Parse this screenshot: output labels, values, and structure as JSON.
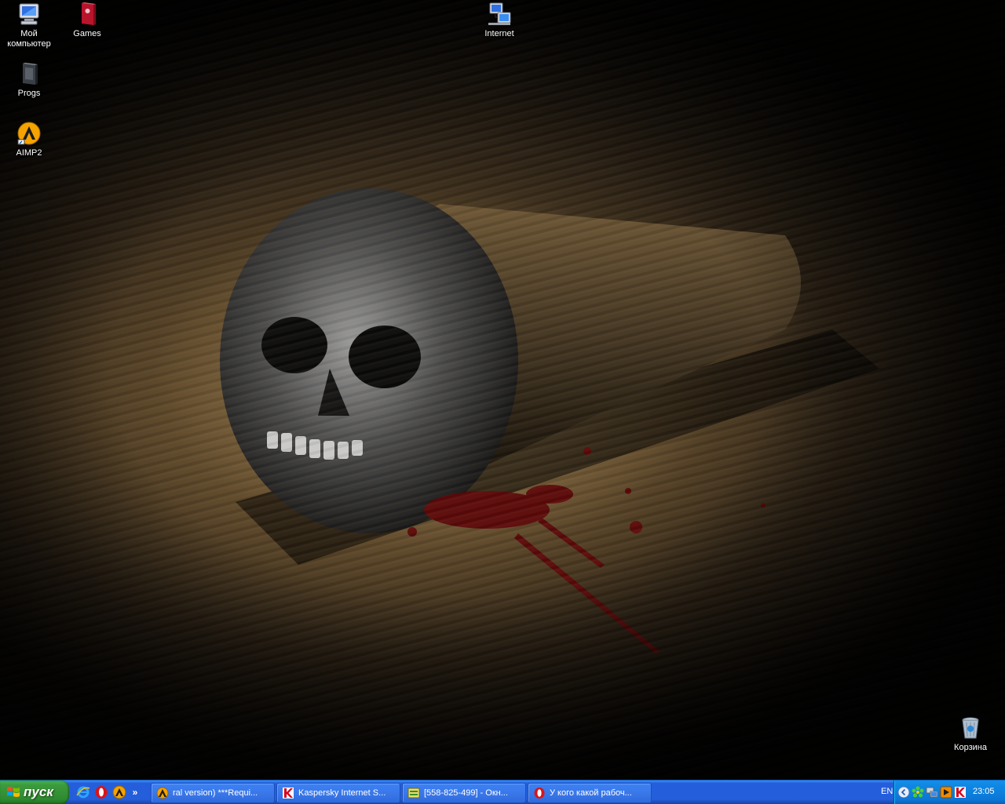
{
  "desktop": {
    "icons": [
      {
        "label": "Мой компьютер",
        "icon": "my-computer-icon"
      },
      {
        "label": "Games",
        "icon": "games-folder-icon"
      },
      {
        "label": "Internet",
        "icon": "network-icon"
      },
      {
        "label": "Progs",
        "icon": "progs-folder-icon"
      },
      {
        "label": "AIMP2",
        "icon": "aimp-icon"
      },
      {
        "label": "Корзина",
        "icon": "recycle-bin-icon"
      }
    ]
  },
  "taskbar": {
    "start_label": "пуск",
    "quick_launch": [
      {
        "icon": "internet-explorer-icon"
      },
      {
        "icon": "opera-icon"
      },
      {
        "icon": "aimp-icon"
      }
    ],
    "quick_launch_more": "»",
    "tasks": [
      {
        "label": "ral version) ***Requi...",
        "icon": "aimp-icon"
      },
      {
        "label": "Kaspersky Internet S...",
        "icon": "kaspersky-icon"
      },
      {
        "label": "[558-825-499] - Окн...",
        "icon": "icq-window-icon"
      },
      {
        "label": "У кого какой рабоч...",
        "icon": "opera-icon"
      }
    ],
    "tray": {
      "language": "EN",
      "clock": "23:05"
    }
  },
  "colors": {
    "taskbar_blue": "#245edb",
    "start_green": "#3c9a3d",
    "tray_blue": "#0f88e4"
  }
}
